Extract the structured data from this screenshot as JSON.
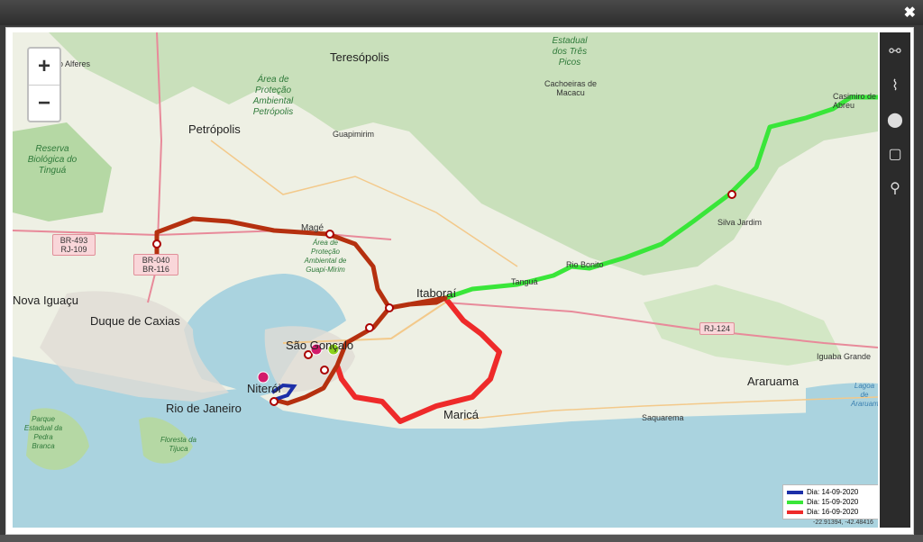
{
  "window": {
    "close_label": "✖"
  },
  "zoom": {
    "in_label": "+",
    "out_label": "−"
  },
  "tools": [
    {
      "icon": "route-icon",
      "glyph": "⚯"
    },
    {
      "icon": "path-icon",
      "glyph": "⌇"
    },
    {
      "icon": "map-marker-icon",
      "glyph": "⬤"
    },
    {
      "icon": "square-icon",
      "glyph": "▢"
    },
    {
      "icon": "multi-marker-icon",
      "glyph": "⚲"
    }
  ],
  "labels": {
    "duque": "Duque de Caxias",
    "rio": "Rio de Janeiro",
    "niteroi": "Niterói",
    "sao_goncalo": "São Gonçalo",
    "itaborai": "Itaboraí",
    "marica": "Maricá",
    "petropolis": "Petrópolis",
    "teresopolis": "Teresópolis",
    "guapimirim": "Guapimirim",
    "cachoeiras": "Cachoeiras de Macacu",
    "silva_jardim": "Silva Jardim",
    "rio_bonito": "Rio Bonito",
    "tangua": "Tanguá",
    "araruama": "Araruama",
    "saquarema": "Saquarema",
    "iguaba": "Iguaba Grande",
    "nova_iguacu": "Nova Iguaçu",
    "mage": "Magé",
    "casimiro": "Casimiro de Abreu",
    "alferes": "do Alferes",
    "reserva_tingua": "Reserva Biológica do Tinguá",
    "apa_petropolis": "Área de Proteção Ambiental Petrópolis",
    "apa_guapimirim": "Área de Proteção Ambiental de Guapi-Mirim",
    "tres_picos": "Estadual dos Três Picos",
    "pedra_branca": "Parque Estadual da Pedra Branca",
    "tijuca": "Floresta da Tijuca",
    "lagoa_araruama": "Lagoa de Araruama"
  },
  "shields": {
    "br493": "BR-493 RJ-109",
    "br040": "BR-040 BR-116",
    "rj124": "RJ-124"
  },
  "legend": [
    {
      "label": "Dia: 14-09-2020",
      "color": "#1c2fa8"
    },
    {
      "label": "Dia: 15-09-2020",
      "color": "#39e639"
    },
    {
      "label": "Dia: 16-09-2020",
      "color": "#ee2a2a"
    }
  ],
  "coordinates": "-22.91394, -42.48416",
  "route_colors": {
    "day14": "#1c2fa8",
    "day15": "#39e639",
    "day16": "#ee2a2a",
    "overlap": "#b5300f"
  }
}
